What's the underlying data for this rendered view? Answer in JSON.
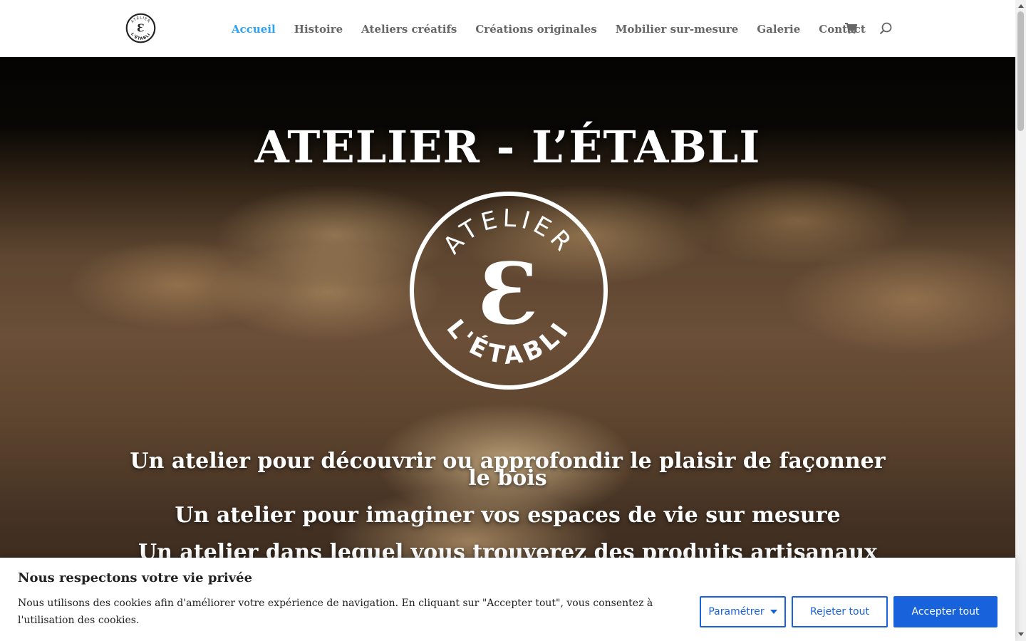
{
  "header": {
    "logo": {
      "top_text": "ATELIER",
      "bottom_text": "L'ÉTABLI",
      "glyph": "Ɛ"
    },
    "nav": [
      {
        "label": "Accueil",
        "active": true
      },
      {
        "label": "Histoire",
        "active": false
      },
      {
        "label": "Ateliers créatifs",
        "active": false
      },
      {
        "label": "Créations originales",
        "active": false
      },
      {
        "label": "Mobilier sur-mesure",
        "active": false
      },
      {
        "label": "Galerie",
        "active": false
      },
      {
        "label": "Contact",
        "active": false
      }
    ],
    "icons": [
      "cart-icon",
      "search-icon"
    ]
  },
  "hero": {
    "title": "ATELIER - L’ÉTABLI",
    "emblem": {
      "top_text": "ATELIER",
      "bottom_text": "L'ÉTABLI",
      "glyph": "Ɛ"
    },
    "taglines": [
      "Un atelier pour découvrir ou approfondir le plaisir de façonner le bois",
      "Un atelier pour imaginer vos espaces de vie sur mesure",
      "Un atelier dans lequel vous trouverez des produits artisanaux"
    ]
  },
  "cookie_banner": {
    "title": "Nous respectons votre vie privée",
    "text": "Nous utilisons des cookies afin d'améliorer votre expérience de navigation. En cliquant sur \"Accepter tout\", vous consentez à l'utilisation des cookies.",
    "buttons": {
      "settings": "Paramétrer",
      "reject": "Rejeter tout",
      "accept": "Accepter tout"
    }
  },
  "colors": {
    "nav_active": "#2ea3f2",
    "nav_text": "#666666",
    "cookie_primary": "#1863dc"
  }
}
